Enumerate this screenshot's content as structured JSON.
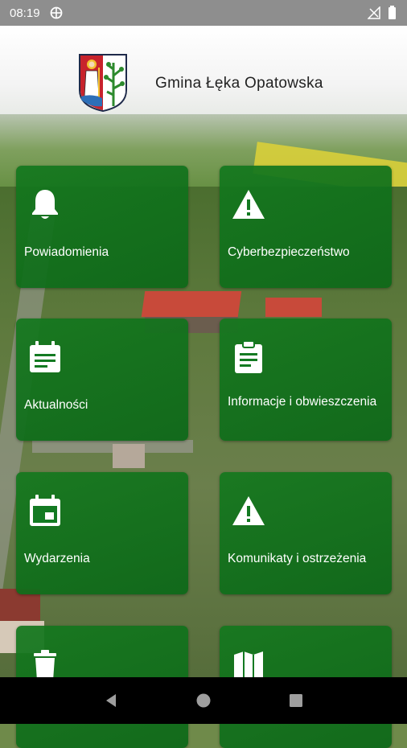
{
  "status_bar": {
    "time": "08:19"
  },
  "header": {
    "title": "Gmina Łęka Opatowska"
  },
  "tiles": [
    {
      "label": "Powiadomienia",
      "icon": "bell-icon"
    },
    {
      "label": "Cyberbezpieczeństwo",
      "icon": "warning-icon"
    },
    {
      "label": "Aktualności",
      "icon": "news-icon"
    },
    {
      "label": "Informacje i obwieszczenia",
      "icon": "clipboard-icon"
    },
    {
      "label": "Wydarzenia",
      "icon": "calendar-icon"
    },
    {
      "label": "Komunikaty i ostrzeżenia",
      "icon": "warning-icon"
    },
    {
      "label": "",
      "icon": "trash-icon"
    },
    {
      "label": "",
      "icon": "map-icon"
    }
  ],
  "colors": {
    "tile": "#137a22",
    "status_bar": "#8e8e8e",
    "nav_bar": "#000000"
  }
}
